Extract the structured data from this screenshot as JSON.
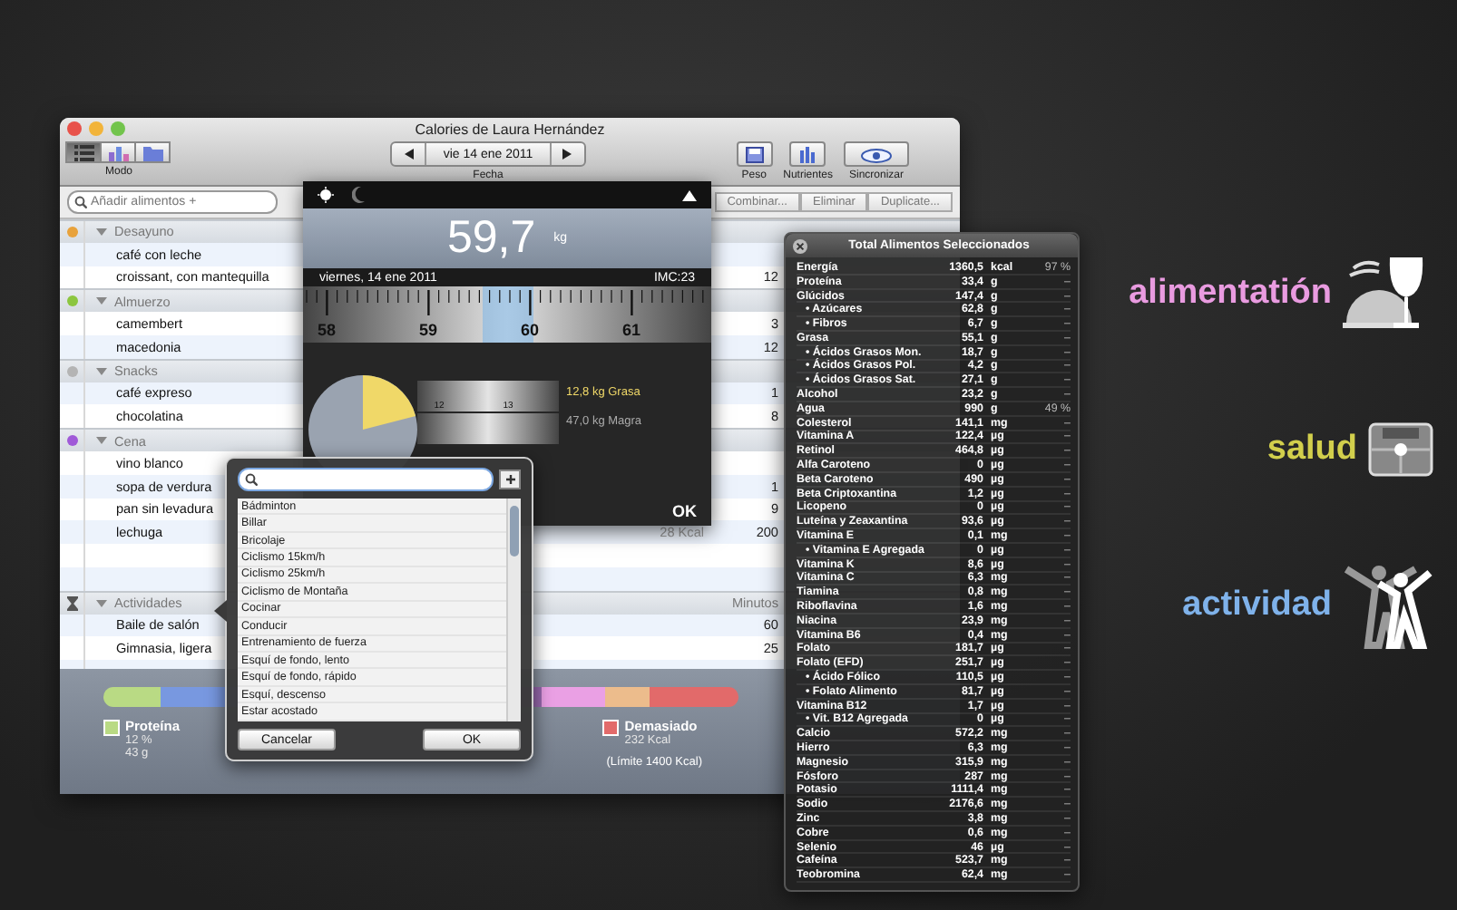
{
  "window": {
    "title": "Calories de Laura Hernández"
  },
  "toolbar": {
    "mode_label": "Modo",
    "modes": [
      {
        "kind": "list",
        "selected": true
      },
      {
        "kind": "chart",
        "selected": false
      },
      {
        "kind": "folder",
        "selected": false
      }
    ],
    "date": "vie 14 ene 2011",
    "date_label": "Fecha",
    "buttons": [
      {
        "kind": "scale",
        "label": "Peso"
      },
      {
        "kind": "bars",
        "label": "Nutrientes"
      },
      {
        "kind": "sync",
        "label": "Sincronizar"
      }
    ]
  },
  "search": {
    "placeholder": "Añadir alimentos +"
  },
  "actions": [
    "Combinar...",
    "Eliminar",
    "Duplicate..."
  ],
  "groups": [
    {
      "kind": "meal",
      "name": "Desayuno",
      "color": "#e8a23c",
      "expanded": true,
      "items": [
        {
          "name": "café con leche"
        },
        {
          "name": "croissant, con mantequilla",
          "qty": "12"
        }
      ]
    },
    {
      "kind": "meal",
      "name": "Almuerzo",
      "color": "#8cc63f",
      "expanded": true,
      "items": [
        {
          "name": "camembert",
          "qty": "3"
        },
        {
          "name": "macedonia",
          "qty": "12"
        }
      ]
    },
    {
      "kind": "meal",
      "name": "Snacks",
      "color": "#b4b4b4",
      "expanded": true,
      "items": [
        {
          "name": "café expreso",
          "qty": "1"
        },
        {
          "name": "chocolatina",
          "qty": "8"
        }
      ]
    },
    {
      "kind": "meal",
      "name": "Cena",
      "color": "#a05ad8",
      "expanded": true,
      "items": [
        {
          "name": "vino blanco"
        },
        {
          "name": "sopa de verdura",
          "qty": "1"
        },
        {
          "name": "pan sin levadura",
          "qty": "9"
        },
        {
          "name": "lechuga",
          "kcal": "28 Kcal",
          "qty": "200"
        }
      ]
    },
    {
      "kind": "activity",
      "name": "Actividades",
      "column": "Minutos",
      "expanded": true,
      "items": [
        {
          "name": "Baile de salón",
          "qty": "60"
        },
        {
          "name": "Gimnasia, ligera",
          "qty": "25"
        }
      ]
    }
  ],
  "summary": {
    "legend": [
      {
        "name": "Proteína",
        "color": "#b9da84",
        "pct": "12 %",
        "amount": "43 g"
      },
      {
        "name": "Demasiado",
        "color": "#e26a6a",
        "amount": "232 Kcal"
      }
    ],
    "limit": "(Límite 1400 Kcal)"
  },
  "scale": {
    "weight": "59,7",
    "unit": "kg",
    "date": "viernes, 14 ene 2011",
    "bmi": "IMC:23",
    "ticks": [
      "58",
      "59",
      "60",
      "61"
    ],
    "fat_ticks": [
      "12",
      "13"
    ],
    "fat": "12,8 kg Grasa",
    "lean": "47,0 kg Magra",
    "ok": "OK"
  },
  "picker": {
    "activities": [
      "Bádminton",
      "Billar",
      "Bricolaje",
      "Ciclismo 15km/h",
      "Ciclismo 25km/h",
      "Ciclismo de Montaña",
      "Cocinar",
      "Conducir",
      "Entrenamiento de fuerza",
      "Esquí de fondo, lento",
      "Esquí de fondo, rápido",
      "Esquí, descenso",
      "Estar acostado"
    ],
    "cancel": "Cancelar",
    "ok": "OK"
  },
  "nutrients": {
    "title": "Total Alimentos Seleccionados",
    "rows": [
      {
        "name": "Energía",
        "value": "1360,5",
        "unit": "kcal",
        "pct": "97 %"
      },
      {
        "name": "Proteína",
        "value": "33,4",
        "unit": "g",
        "pct": "–"
      },
      {
        "name": "Glúcidos",
        "value": "147,4",
        "unit": "g",
        "pct": "–",
        "children": [
          {
            "name": "• Azúcares",
            "value": "62,8",
            "unit": "g",
            "pct": "–"
          },
          {
            "name": "• Fibros",
            "value": "6,7",
            "unit": "g",
            "pct": "–"
          }
        ]
      },
      {
        "name": "Grasa",
        "value": "55,1",
        "unit": "g",
        "pct": "–",
        "children": [
          {
            "name": "• Ácidos Grasos Mon.",
            "value": "18,7",
            "unit": "g",
            "pct": "–"
          },
          {
            "name": "• Ácidos Grasos Pol.",
            "value": "4,2",
            "unit": "g",
            "pct": "–"
          },
          {
            "name": "• Ácidos Grasos Sat.",
            "value": "27,1",
            "unit": "g",
            "pct": "–"
          }
        ]
      },
      {
        "name": "Alcohol",
        "value": "23,2",
        "unit": "g",
        "pct": "–"
      },
      {
        "name": "Agua",
        "value": "990",
        "unit": "g",
        "pct": "49 %"
      },
      {
        "name": "Colesterol",
        "value": "141,1",
        "unit": "mg",
        "pct": "–"
      },
      {
        "name": "Vitamina A",
        "value": "122,4",
        "unit": "µg",
        "pct": "–"
      },
      {
        "name": "Retinol",
        "value": "464,8",
        "unit": "µg",
        "pct": "–"
      },
      {
        "name": "Alfa Caroteno",
        "value": "0",
        "unit": "µg",
        "pct": "–"
      },
      {
        "name": "Beta Caroteno",
        "value": "490",
        "unit": "µg",
        "pct": "–"
      },
      {
        "name": "Beta Criptoxantina",
        "value": "1,2",
        "unit": "µg",
        "pct": "–"
      },
      {
        "name": "Licopeno",
        "value": "0",
        "unit": "µg",
        "pct": "–"
      },
      {
        "name": "Luteína y Zeaxantina",
        "value": "93,6",
        "unit": "µg",
        "pct": "–"
      },
      {
        "name": "Vitamina E",
        "value": "0,1",
        "unit": "mg",
        "pct": "–",
        "children": [
          {
            "name": "• Vitamina E Agregada",
            "value": "0",
            "unit": "µg",
            "pct": "–"
          }
        ]
      },
      {
        "name": "Vitamina K",
        "value": "8,6",
        "unit": "µg",
        "pct": "–"
      },
      {
        "name": "Vitamina C",
        "value": "6,3",
        "unit": "mg",
        "pct": "–"
      },
      {
        "name": "Tiamina",
        "value": "0,8",
        "unit": "mg",
        "pct": "–"
      },
      {
        "name": "Riboflavina",
        "value": "1,6",
        "unit": "mg",
        "pct": "–"
      },
      {
        "name": "Niacina",
        "value": "23,9",
        "unit": "mg",
        "pct": "–"
      },
      {
        "name": "Vitamina B6",
        "value": "0,4",
        "unit": "mg",
        "pct": "–"
      },
      {
        "name": "Folato",
        "value": "181,7",
        "unit": "µg",
        "pct": "–"
      },
      {
        "name": "Folato (EFD)",
        "value": "251,7",
        "unit": "µg",
        "pct": "–",
        "children": [
          {
            "name": "• Ácido Fólico",
            "value": "110,5",
            "unit": "µg",
            "pct": "–"
          },
          {
            "name": "• Folato Alimento",
            "value": "81,7",
            "unit": "µg",
            "pct": "–"
          }
        ]
      },
      {
        "name": "Vitamina B12",
        "value": "1,7",
        "unit": "µg",
        "pct": "–",
        "children": [
          {
            "name": "• Vit. B12 Agregada",
            "value": "0",
            "unit": "µg",
            "pct": "–"
          }
        ]
      },
      {
        "name": "Calcio",
        "value": "572,2",
        "unit": "mg",
        "pct": "–"
      },
      {
        "name": "Hierro",
        "value": "6,3",
        "unit": "mg",
        "pct": "–"
      },
      {
        "name": "Magnesio",
        "value": "315,9",
        "unit": "mg",
        "pct": "–"
      },
      {
        "name": "Fósforo",
        "value": "287",
        "unit": "mg",
        "pct": "–"
      },
      {
        "name": "Potasio",
        "value": "1111,4",
        "unit": "mg",
        "pct": "–"
      },
      {
        "name": "Sodio",
        "value": "2176,6",
        "unit": "mg",
        "pct": "–"
      },
      {
        "name": "Zinc",
        "value": "3,8",
        "unit": "mg",
        "pct": "–"
      },
      {
        "name": "Cobre",
        "value": "0,6",
        "unit": "mg",
        "pct": "–"
      },
      {
        "name": "Selenio",
        "value": "46",
        "unit": "µg",
        "pct": "–"
      },
      {
        "name": "Cafeína",
        "value": "523,7",
        "unit": "mg",
        "pct": "–"
      },
      {
        "name": "Teobromina",
        "value": "62,4",
        "unit": "mg",
        "pct": "–"
      }
    ]
  },
  "features": [
    {
      "kind": "food",
      "label": "alimentatión",
      "color": "#e99be0"
    },
    {
      "kind": "scale",
      "label": "salud",
      "color": "#d2cf4c"
    },
    {
      "kind": "people",
      "label": "actividad",
      "color": "#7fb2ea"
    }
  ]
}
